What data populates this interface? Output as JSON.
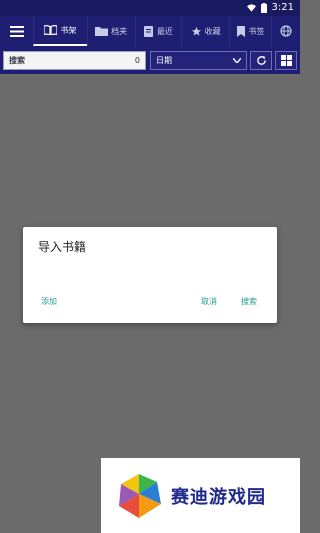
{
  "status_bar": {
    "time": "3:21"
  },
  "toolbar": {
    "tabs": [
      {
        "label": "书架",
        "icon": "book-open-icon"
      },
      {
        "label": "档夹",
        "icon": "folder-icon"
      },
      {
        "label": "最近",
        "icon": "recent-icon"
      },
      {
        "label": "收藏",
        "icon": "star-icon"
      },
      {
        "label": "书签",
        "icon": "bookmark-icon"
      }
    ]
  },
  "filter": {
    "search_label": "搜索",
    "count": "0",
    "sort_label": "日期"
  },
  "dialog": {
    "title": "导入书籍",
    "add_label": "添加",
    "cancel_label": "取消",
    "search_label": "搜索"
  },
  "watermark": {
    "text": "赛迪游戏园"
  },
  "colors": {
    "toolbar": "#1e1e72",
    "accent": "#2a9d8f",
    "overlay": "#6b6b6b"
  }
}
